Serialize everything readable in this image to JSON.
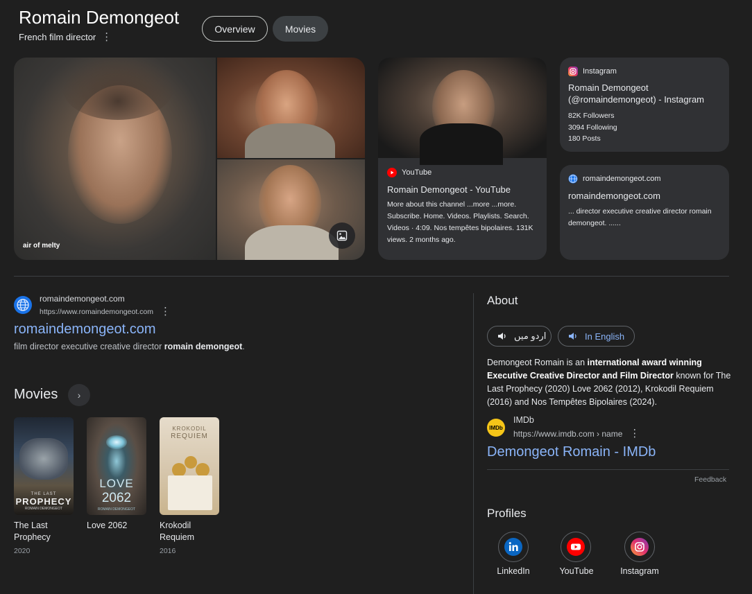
{
  "header": {
    "title": "Romain Demongeot",
    "subtitle": "French film director",
    "tabs": [
      {
        "label": "Overview"
      },
      {
        "label": "Movies"
      }
    ]
  },
  "images": {
    "caption": "air of melty"
  },
  "youtube_card": {
    "source": "YouTube",
    "title": "Romain Demongeot - YouTube",
    "body": "More about this channel ...more ...more. Subscribe. Home. Videos. Playlists. Search. Videos · 4:09. Nos tempêtes bipolaires. 131K views. 2 months ago."
  },
  "instagram_card": {
    "source": "Instagram",
    "title": "Romain Demongeot (@romaindemongeot) - Instagram",
    "followers": "82K Followers",
    "following": "3094 Following",
    "posts": "180 Posts"
  },
  "site_card": {
    "source": "romaindemongeot.com",
    "title": "romaindemongeot.com",
    "body": "... director executive creative director romain demongeot. ......"
  },
  "result": {
    "site_name": "romaindemongeot.com",
    "url": "https://www.romaindemongeot.com",
    "link_title": "romaindemongeot.com",
    "snippet_plain": "film director executive creative director ",
    "snippet_bold": "romain demongeot",
    "snippet_end": "."
  },
  "movies": {
    "heading": "Movies",
    "items": [
      {
        "title": "The Last Prophecy",
        "year": "2020",
        "poster_top": "THE LAST",
        "poster_main": "PROPHECY",
        "poster_sub": "ROMAIN DEMONGEOT"
      },
      {
        "title": "Love 2062",
        "year": "",
        "poster_top": "LOVE",
        "poster_main": "2062",
        "poster_sub": "ROMAIN DEMONGEOT"
      },
      {
        "title": "Krokodil Requiem",
        "year": "2016",
        "poster_top": "KROKODIL",
        "poster_main": "REQUIEM",
        "poster_sub": ""
      }
    ]
  },
  "about": {
    "heading": "About",
    "lang_urdu": "اردو میں",
    "lang_english": "In English",
    "text_1": "Demongeot Romain is an ",
    "text_bold": "international award winning Executive Creative Director and Film Director",
    "text_2": " known for The Last Prophecy (2020) Love 2062 (2012), Krokodil Requiem (2016) and Nos Tempêtes Bipolaires (2024).",
    "source_name": "IMDb",
    "source_logo": "IMDb",
    "source_url": "https://www.imdb.com › name",
    "source_link": "Demongeot Romain - IMDb",
    "feedback": "Feedback"
  },
  "profiles": {
    "heading": "Profiles",
    "items": [
      {
        "label": "LinkedIn",
        "icon": "linkedin-icon",
        "color": "#0a66c2"
      },
      {
        "label": "YouTube",
        "icon": "youtube-icon",
        "color": "#ff0000"
      },
      {
        "label": "Instagram",
        "icon": "instagram-icon",
        "color": "#c13584"
      }
    ]
  },
  "colors": {
    "background": "#1f1f1f",
    "card": "#303134",
    "link": "#8ab4f8"
  }
}
